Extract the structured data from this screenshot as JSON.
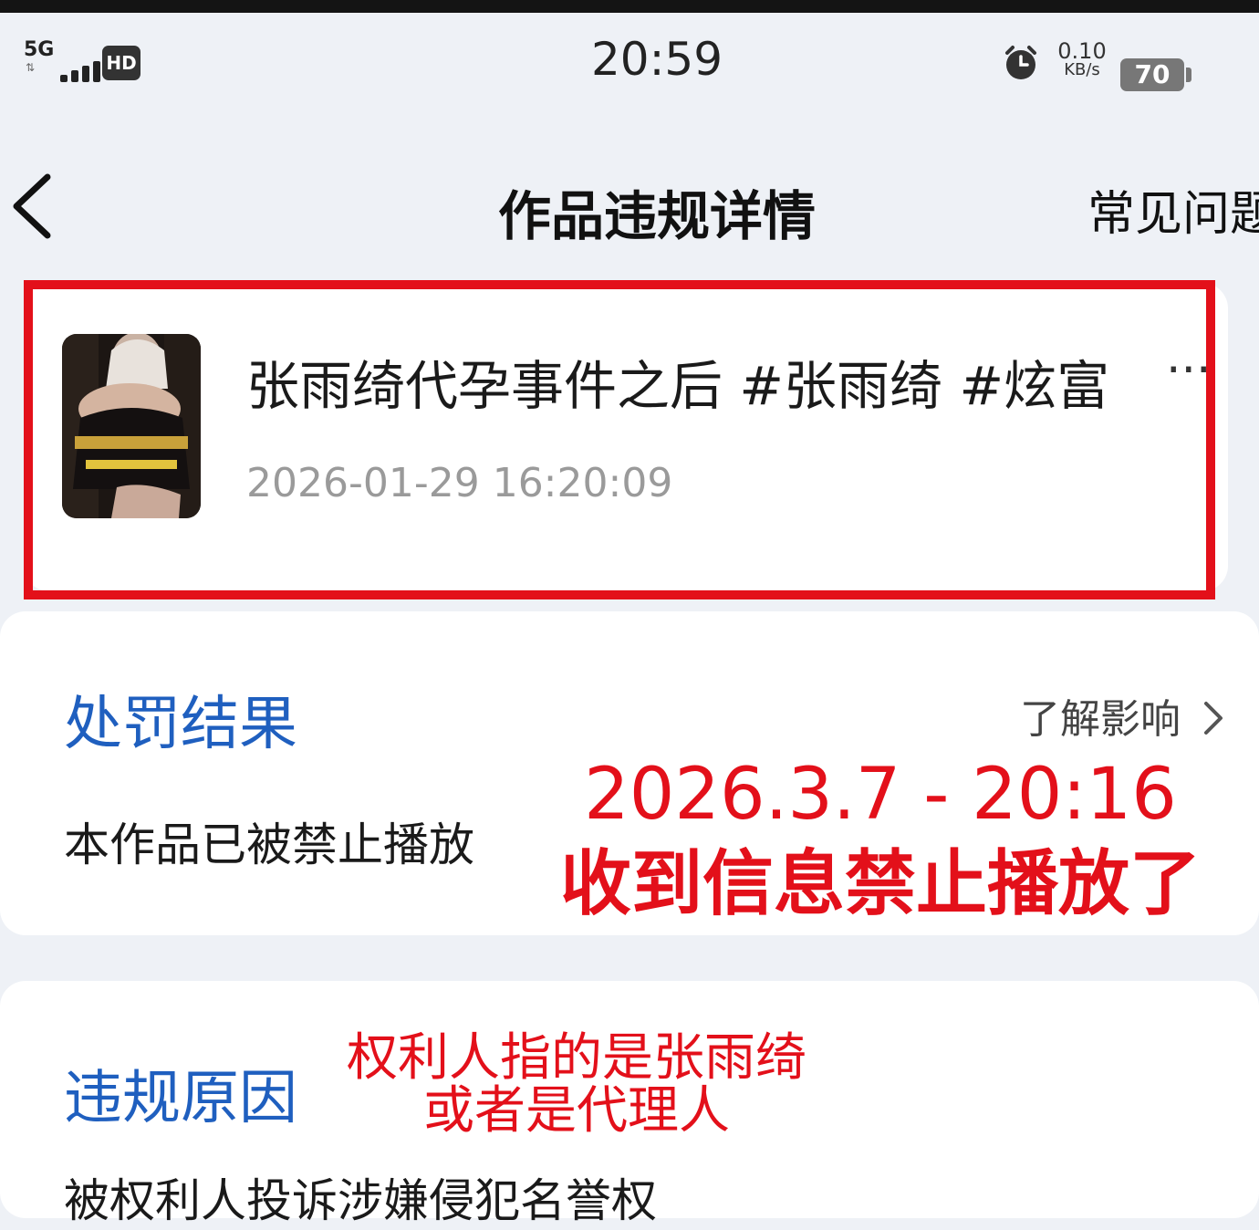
{
  "status_bar": {
    "network": "5G",
    "hd_badge": "HD",
    "time": "20:59",
    "speed_value": "0.10",
    "speed_unit": "KB/s",
    "battery": "70"
  },
  "nav": {
    "title": "作品违规详情",
    "faq_label": "常见问题"
  },
  "work": {
    "title": "张雨绮代孕事件之后 #张雨绮 #炫富",
    "more": "···",
    "timestamp": "2026-01-29 16:20:09"
  },
  "penalty": {
    "section_title": "处罚结果",
    "learn_more": "了解影响",
    "result_text": "本作品已被禁止播放",
    "annotation_line1": "2026.3.7 - 20:16",
    "annotation_line2": "收到信息禁止播放了"
  },
  "reason": {
    "section_title": "违规原因",
    "annotation_line1": "权利人指的是张雨绮",
    "annotation_line2": "或者是代理人",
    "reason_text": "被权利人投诉涉嫌侵犯名誉权"
  },
  "colors": {
    "accent_blue": "#1f5fbf",
    "annotation_red": "#e3101a",
    "background": "#eef1f6"
  }
}
